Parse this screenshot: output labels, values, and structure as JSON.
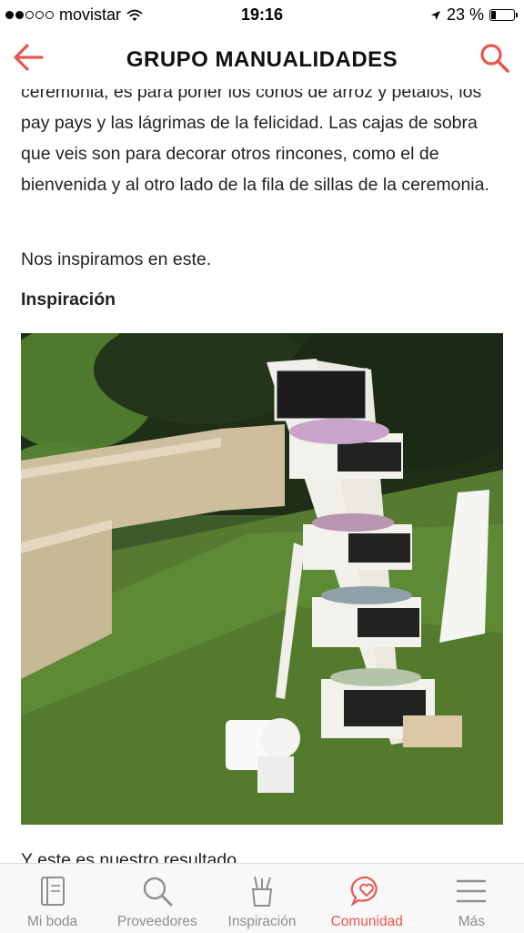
{
  "status_bar": {
    "carrier": "movistar",
    "time": "19:16",
    "battery": "23 %",
    "battery_level": 0.23
  },
  "nav": {
    "title": "GRUPO MANUALIDADES",
    "back_icon": "back-arrow-icon",
    "search_icon": "search-icon",
    "accent_color": "#e8574c"
  },
  "post": {
    "paragraph_cut": "ceremonia, es para poner los conos de arroz y pétalos, los pay pays y las lágrimas de la felicidad. Las cajas de sobra que veis son para decorar otros rincones, como el de bienvenida y al otro lado de la fila de sillas de la ceremonia.",
    "paragraph_inspire": "Nos inspiramos en este.",
    "heading": "Inspiración",
    "paragraph_result": "Y este es nuestro resultado"
  },
  "tabs": [
    {
      "label": "Mi boda",
      "icon": "notebook-icon",
      "active": false
    },
    {
      "label": "Proveedores",
      "icon": "search-icon",
      "active": false
    },
    {
      "label": "Inspiración",
      "icon": "pencil-cup-icon",
      "active": false
    },
    {
      "label": "Comunidad",
      "icon": "heart-bubble-icon",
      "active": true
    },
    {
      "label": "Más",
      "icon": "menu-icon",
      "active": false
    }
  ]
}
